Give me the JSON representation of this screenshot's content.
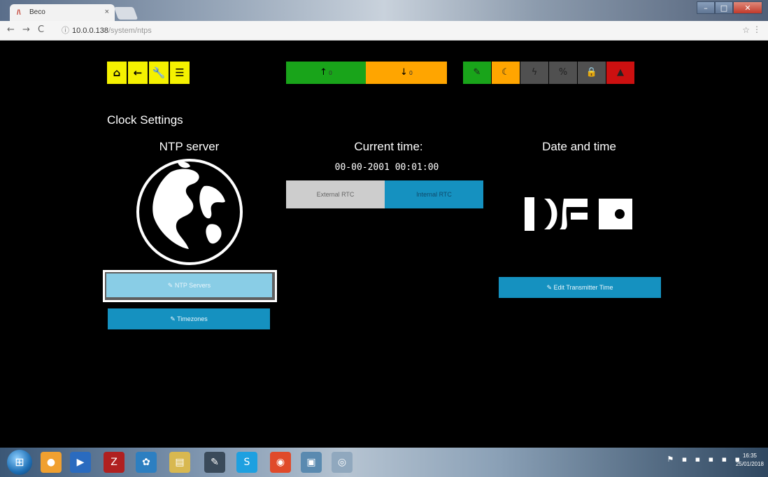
{
  "browser": {
    "tab_title": "Beco",
    "tab_close": "×",
    "url_host": "10.0.0.138",
    "url_path": "/system/ntps",
    "back": "←",
    "forward": "→",
    "reload": "C",
    "star": "☆",
    "menu": "⋮",
    "window_buttons": [
      "–",
      "□",
      "✕"
    ]
  },
  "topnav": {
    "buttons": [
      {
        "icon": "home-icon",
        "glyph": "⌂"
      },
      {
        "icon": "back-arrow-icon",
        "glyph": "←"
      },
      {
        "icon": "wrench-icon",
        "glyph": "🔧"
      },
      {
        "icon": "menu-icon",
        "glyph": "☰"
      }
    ],
    "up_glyph": "↑",
    "up_value": "0",
    "down_glyph": "↓",
    "down_value": "0",
    "status_icons": [
      {
        "icon": "plug-icon",
        "glyph": "✎",
        "color": "#19a41a"
      },
      {
        "icon": "moon-icon",
        "glyph": "☾",
        "color": "#ffa500"
      },
      {
        "icon": "lightning-icon",
        "glyph": "ϟ",
        "color": "#505050"
      },
      {
        "icon": "link-icon",
        "glyph": "%",
        "color": "#505050"
      },
      {
        "icon": "lock-icon",
        "glyph": "🔒",
        "color": "#505050"
      },
      {
        "icon": "warning-icon",
        "glyph": "▲",
        "color": "#cc1010"
      }
    ]
  },
  "page": {
    "heading": "Clock Settings",
    "ntp_title": "NTP server",
    "current_title": "Current time:",
    "current_time": "00-00-2001 00:01:00",
    "datetime_title": "Date and time",
    "rtc_external": "External RTC",
    "rtc_internal": "Internal RTC",
    "ntp_button": "✎ NTP Servers",
    "timezones_button": "✎ Timezones",
    "edit_time_button": "✎ Edit Transmitter Time"
  },
  "taskbar": {
    "tray": "⚑ ▪ ▪ ▪ ▪ ▪",
    "time": "16:35",
    "date": "25/01/2018"
  }
}
